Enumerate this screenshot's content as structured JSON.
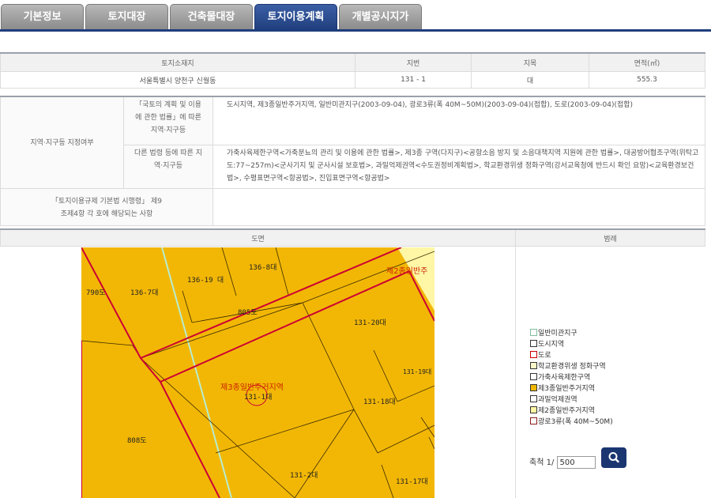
{
  "tabs": [
    "기본정보",
    "토지대장",
    "건축물대장",
    "토지이용계획",
    "개별공시지가"
  ],
  "info_table": {
    "headers": [
      "토지소재지",
      "지번",
      "지목",
      "면적(㎡)"
    ],
    "row": [
      "서울특별시 양천구 신월동",
      "131 - 1",
      "대",
      "555.3"
    ]
  },
  "zone_table": {
    "left_header": "지역·지구등 지정여부",
    "row1_header": "「국토의 계획 및 이용에 관한 법률」에 따른 지역·지구등",
    "row1_text": "도시지역, 제3종일반주거지역, 일반미관지구(2003-09-04), 광로3류(폭 40M~50M)(2003-09-04)(접합), 도로(2003-09-04)(접합)",
    "row2_header": "다른 법령 등에 따른 지역·지구등",
    "row2_text": "가축사육제한구역<가축분뇨의 관리 및 이용에 관한 법률>, 제3종 구역(다지구)<공항소음 방지 및 소음대책지역 지원에 관한 법률>, 대공방어협조구역(위탁고도:77~257m)<군사기지 및 군사시설 보호법>, 과밀억제권역<수도권정비계획법>, 학교환경위생 정화구역(강서교육청에 반드시 확인 요망)<교육환경보건법>, 수평표면구역<항공법>, 진입표면구역<항공법>",
    "row3_header": "「토지이용규제 기본법 시행령」 제9조제4항 각 호에 해당되는 사항",
    "row3_text": ""
  },
  "map_section": {
    "map_header": "도면",
    "legend_header": "범례"
  },
  "map_labels": {
    "l790": "790도",
    "l136_7": "136-7대",
    "l136_19": "136-19 대",
    "l136_8": "136-8대",
    "l805": "805도",
    "l131_20": "131-20대",
    "l131_19": "131-19대",
    "l131_1": "131-1대",
    "l131_18": "131-18대",
    "l808": "808도",
    "l131_2": "131-2대",
    "l131_17": "131-17대",
    "zone3": "제3종일반주거지역",
    "zone2": "제2종일반주"
  },
  "legend": [
    {
      "label": "일반미관지구",
      "color": "#ffffff",
      "border": "#7fbf9f"
    },
    {
      "label": "도시지역",
      "color": "#ffffff",
      "border": "#333333"
    },
    {
      "label": "도로",
      "color": "#ffffff",
      "border": "#cc0000"
    },
    {
      "label": "학교환경위생 정화구역",
      "color": "#fbf7c9",
      "border": "#333333"
    },
    {
      "label": "가축사육제한구역",
      "color": "#ffffff",
      "border": "#333333"
    },
    {
      "label": "제3종일반주거지역",
      "color": "#f2b705",
      "border": "#333333"
    },
    {
      "label": "과밀억제권역",
      "color": "#ffffff",
      "border": "#333333"
    },
    {
      "label": "제2종일반주거지역",
      "color": "#fff6a6",
      "border": "#333333"
    },
    {
      "label": "광로3류(폭 40M~50M)",
      "color": "#ffffff",
      "border": "#8b1a1a"
    }
  ],
  "scale": {
    "label": "축척 1/",
    "value": "500"
  },
  "colors": {
    "tab_active": "#203e7d",
    "zone3_fill": "#f2b705",
    "zone2_fill": "#fff6a6",
    "road_line": "#cc0033"
  }
}
